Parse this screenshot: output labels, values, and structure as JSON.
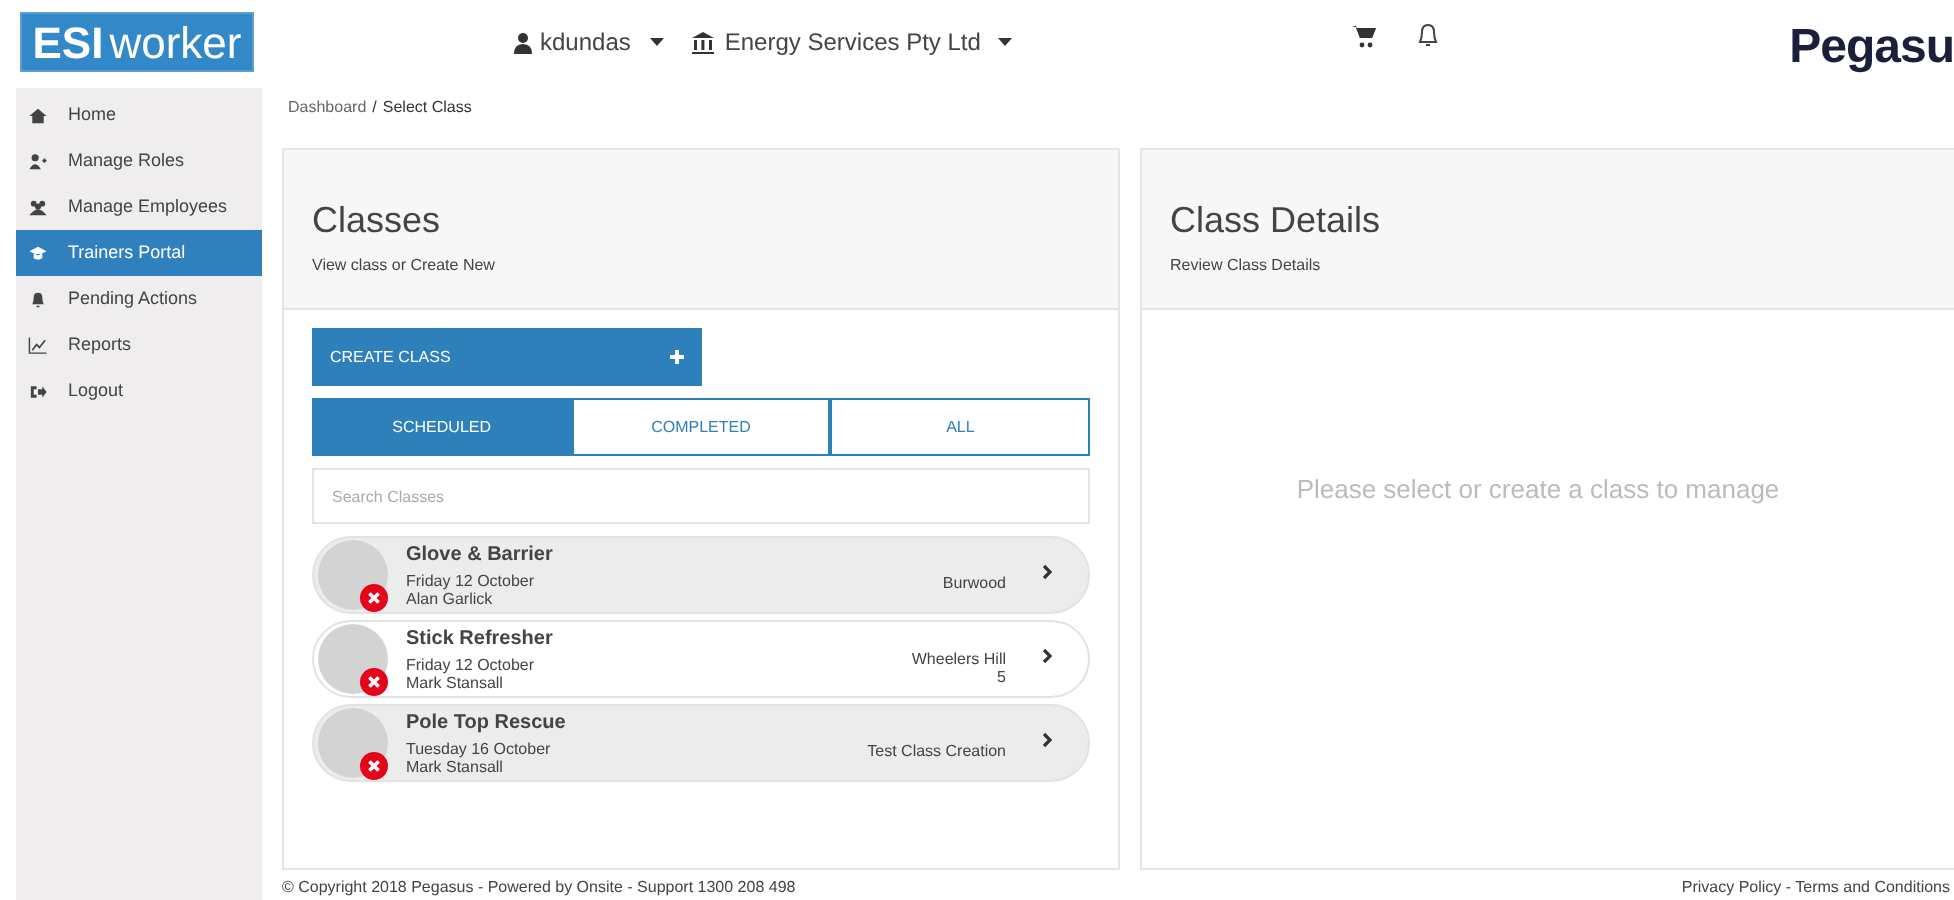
{
  "header": {
    "logo": {
      "bold": "ESI",
      "rest": "worker"
    },
    "user": "kdundas",
    "company": "Energy Services Pty Ltd",
    "brand": "Pegasu"
  },
  "sidebar": {
    "items": [
      {
        "label": "Home",
        "selected": false
      },
      {
        "label": "Manage Roles",
        "selected": false
      },
      {
        "label": "Manage Employees",
        "selected": false
      },
      {
        "label": "Trainers Portal",
        "selected": true
      },
      {
        "label": "Pending Actions",
        "selected": false
      },
      {
        "label": "Reports",
        "selected": false
      },
      {
        "label": "Logout",
        "selected": false
      }
    ]
  },
  "breadcrumb": {
    "link": "Dashboard",
    "separator": "/",
    "current": "Select Class"
  },
  "classes_panel": {
    "title": "Classes",
    "subtitle": "View class or Create New",
    "create_button": "CREATE CLASS",
    "tabs": [
      {
        "label": "SCHEDULED",
        "selected": true
      },
      {
        "label": "COMPLETED",
        "selected": false
      },
      {
        "label": "ALL",
        "selected": false
      }
    ],
    "search": {
      "placeholder": "Search Classes"
    },
    "classes": [
      {
        "name": "Glove & Barrier",
        "date": "Friday 12 October",
        "trainer": "Alan Garlick",
        "location": "Burwood",
        "selected": false
      },
      {
        "name": "Stick Refresher",
        "date": "Friday 12 October",
        "trainer": "Mark Stansall",
        "location": "Wheelers Hill",
        "count": "5",
        "selected": true
      },
      {
        "name": "Pole Top Rescue",
        "date": "Tuesday 16 October",
        "trainer": "Mark Stansall",
        "location": "Test Class Creation",
        "selected": false
      }
    ]
  },
  "details_panel": {
    "title": "Class Details",
    "subtitle": "Review Class Details",
    "empty_message": "Please select or create a class to manage"
  },
  "footer": {
    "copyright": "© Copyright 2018 Pegasus - Powered by Onsite - Support 1300 208 498",
    "links": "Privacy Policy - Terms and Conditions"
  }
}
